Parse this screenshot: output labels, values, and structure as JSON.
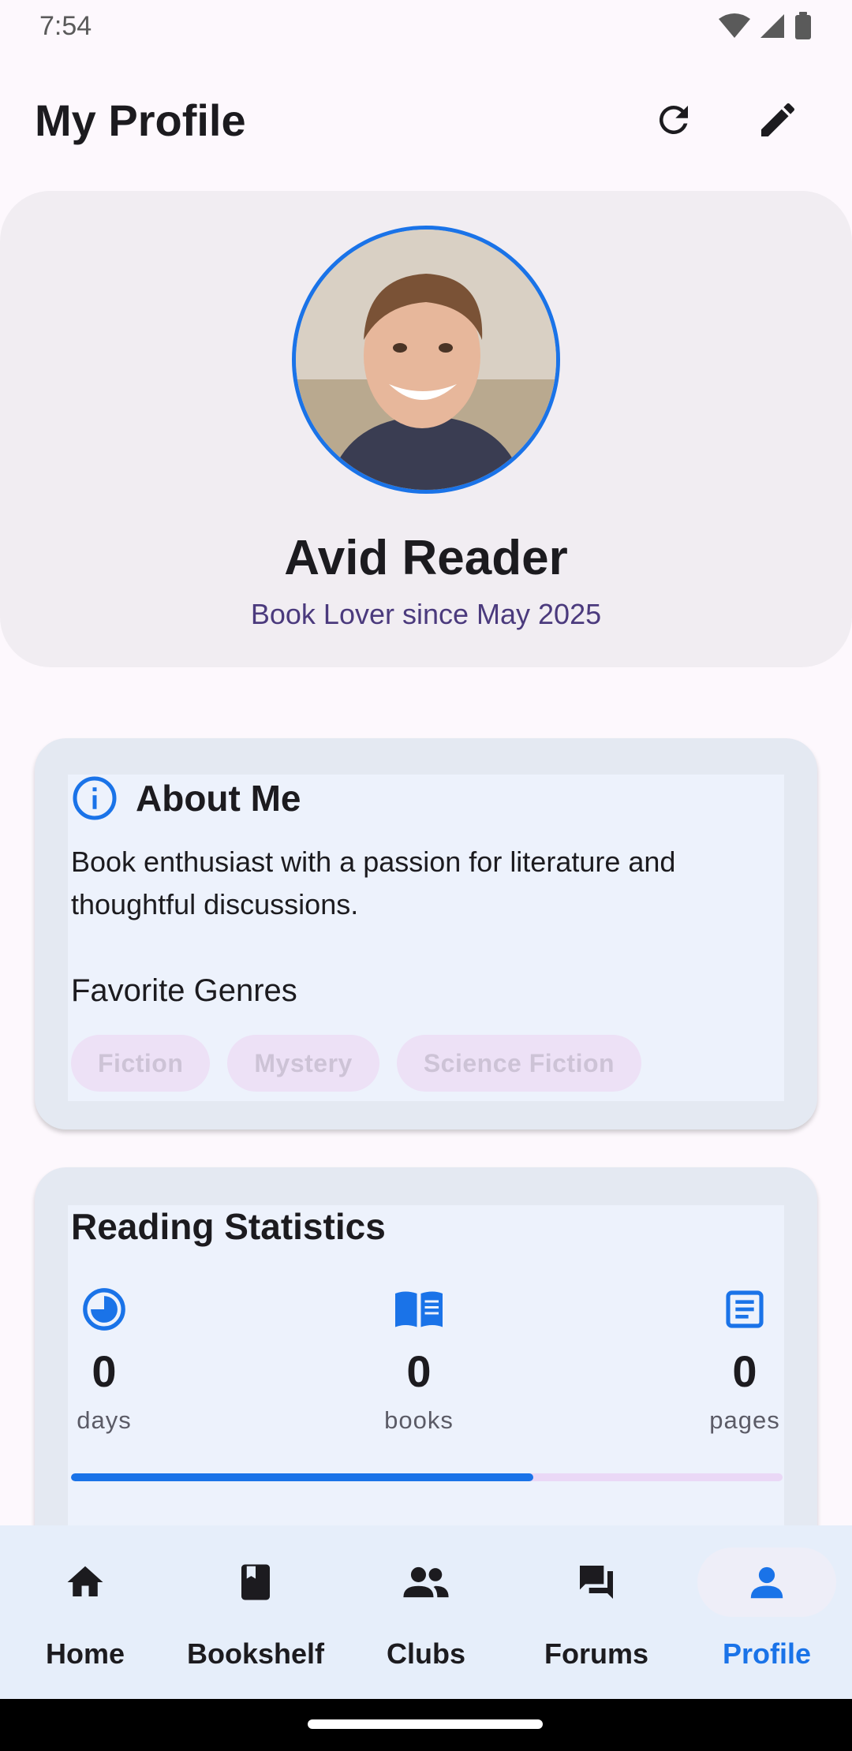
{
  "status_bar": {
    "time": "7:54"
  },
  "header": {
    "title": "My Profile",
    "refresh_icon": "refresh-icon",
    "edit_icon": "edit-pencil-icon"
  },
  "profile": {
    "name": "Avid Reader",
    "since": "Book Lover since May 2025",
    "avatar_border_color": "#1a73e8"
  },
  "about": {
    "title": "About Me",
    "icon": "info-icon",
    "bio": "Book enthusiast with a passion for literature and thoughtful discussions.",
    "genres_title": "Favorite Genres",
    "genres": [
      "Fiction",
      "Mystery",
      "Science Fiction"
    ]
  },
  "stats": {
    "title": "Reading Statistics",
    "items": [
      {
        "value": "0",
        "label": "days",
        "icon": "timer-pie-icon"
      },
      {
        "value": "0",
        "label": "books",
        "icon": "open-book-icon"
      },
      {
        "value": "0",
        "label": "pages",
        "icon": "article-icon"
      }
    ],
    "progress_fraction": 0.65
  },
  "nav": {
    "items": [
      {
        "label": "Home",
        "icon": "home-icon",
        "active": false
      },
      {
        "label": "Bookshelf",
        "icon": "book-icon",
        "active": false
      },
      {
        "label": "Clubs",
        "icon": "group-icon",
        "active": false
      },
      {
        "label": "Forums",
        "icon": "forum-icon",
        "active": false
      },
      {
        "label": "Profile",
        "icon": "person-icon",
        "active": true
      }
    ]
  },
  "colors": {
    "accent": "#1a73e8",
    "chip_bg": "#ede1f6",
    "subtitle": "#4b3a7d"
  }
}
